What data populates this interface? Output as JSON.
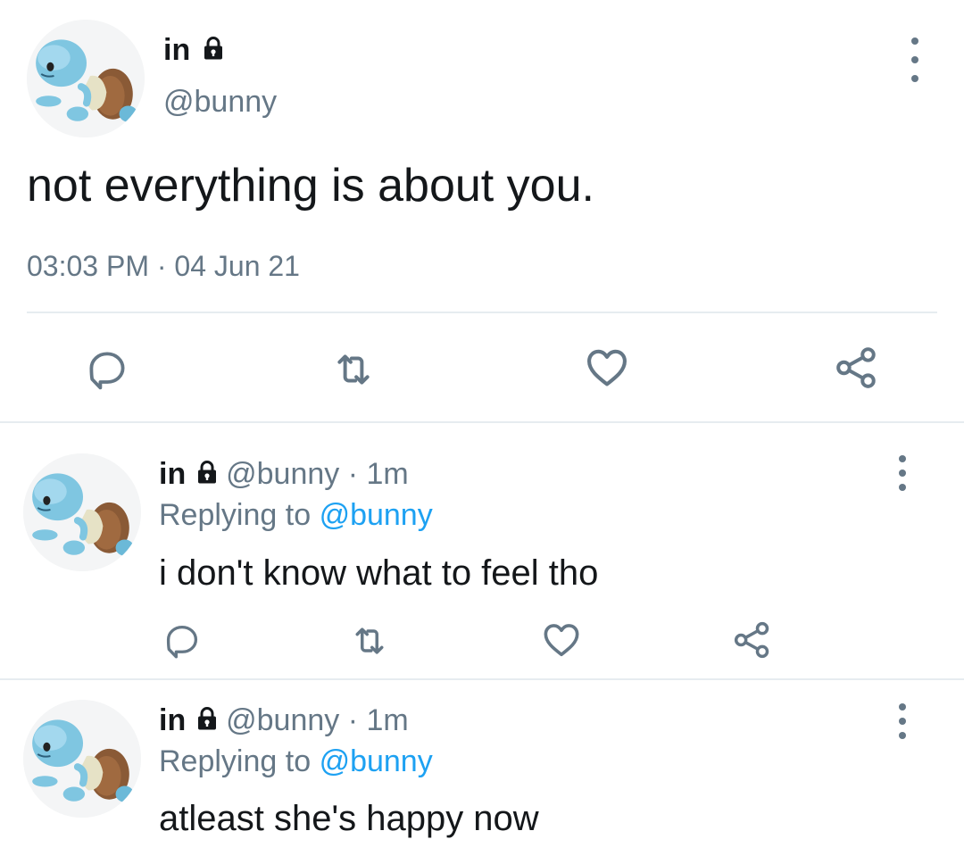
{
  "main_tweet": {
    "display_name": "in",
    "handle": "@bunny",
    "text": "not everything is about you.",
    "time": "03:03 PM",
    "separator": "·",
    "date": "04 Jun 21"
  },
  "replies": [
    {
      "display_name": "in",
      "handle": "@bunny",
      "separator": "·",
      "age": "1m",
      "replying_prefix": "Replying to",
      "replying_to": "@bunny",
      "text": "i don't know what to feel tho"
    },
    {
      "display_name": "in",
      "handle": "@bunny",
      "separator": "·",
      "age": "1m",
      "replying_prefix": "Replying to",
      "replying_to": "@bunny",
      "text": "atleast she's happy now"
    }
  ],
  "icons": {
    "lock": "lock-icon",
    "more": "more-vertical-icon",
    "reply": "reply-icon",
    "retweet": "retweet-icon",
    "like": "heart-icon",
    "share": "share-icon"
  },
  "colors": {
    "text": "#14171a",
    "secondary": "#657786",
    "link": "#1da1f2",
    "divider": "#e6ecf0"
  }
}
